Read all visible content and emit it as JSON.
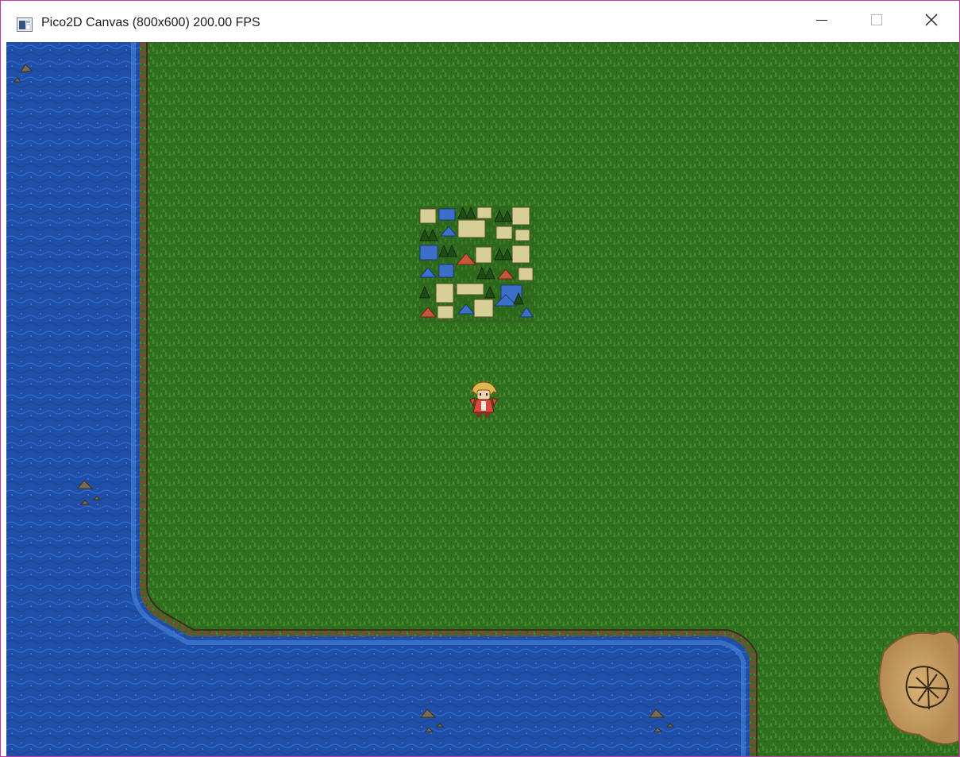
{
  "window": {
    "title": "Pico2D Canvas (800x600) 200.00 FPS",
    "icon": "app-window-icon",
    "controls": [
      "minimize-icon",
      "maximize-icon",
      "close-icon"
    ],
    "border_color": "#c238a6"
  },
  "scene": {
    "sprites": [
      "town",
      "player-character",
      "crater",
      "sea-rocks"
    ],
    "colors": {
      "grass": "#2f6f1e",
      "grass_light": "#3f8a28",
      "water": "#1f4fa8",
      "water_light": "#2f6ad0",
      "shore": "#6b5236",
      "sand": "#c9a063"
    }
  }
}
